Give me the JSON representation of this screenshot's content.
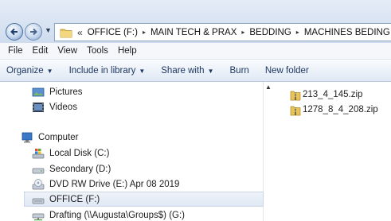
{
  "address_bar": {
    "overflow_glyph": "«",
    "crumbs": [
      "OFFICE (F:)",
      "MAIN TECH & PRAX",
      "BEDDING",
      "MACHINES BEDING"
    ],
    "separator": "▸"
  },
  "menu": [
    "File",
    "Edit",
    "View",
    "Tools",
    "Help"
  ],
  "commands": {
    "organize": "Organize",
    "include": "Include in library",
    "share": "Share with",
    "burn": "Burn",
    "new_folder": "New folder",
    "dropdown_glyph": "▼"
  },
  "navigation": {
    "pictures": "Pictures",
    "videos": "Videos",
    "computer": "Computer",
    "local_disk": "Local Disk (C:)",
    "secondary": "Secondary (D:)",
    "dvd": "DVD RW Drive (E:) Apr 08 2019",
    "office": "OFFICE (F:)",
    "drafting": "Drafting (\\\\Augusta\\Groups$) (G:)"
  },
  "files": [
    "213_4_145.zip",
    "1278_8_4_208.zip"
  ],
  "colors": {
    "accent": "#1e3760",
    "selection": "#dfe8f4",
    "folder": "#e8c35a"
  }
}
